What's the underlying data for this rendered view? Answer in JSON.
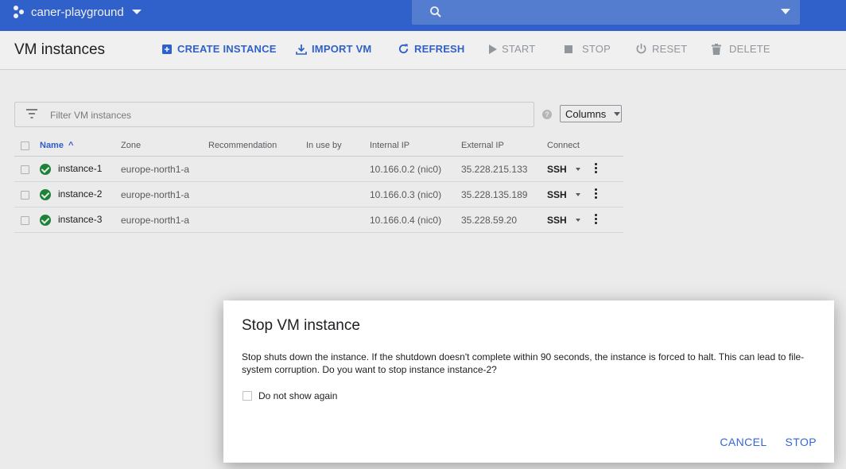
{
  "topbar": {
    "project_name": "caner-playground",
    "search_placeholder": ""
  },
  "toolbar": {
    "page_title": "VM instances",
    "create_instance": "CREATE INSTANCE",
    "import_vm": "IMPORT VM",
    "refresh": "REFRESH",
    "start": "START",
    "stop": "STOP",
    "reset": "RESET",
    "delete": "DELETE"
  },
  "filter": {
    "placeholder": "Filter VM instances",
    "help": "?",
    "columns_label": "Columns"
  },
  "table": {
    "headers": {
      "name": "Name",
      "zone": "Zone",
      "recommendation": "Recommendation",
      "in_use_by": "In use by",
      "internal_ip": "Internal IP",
      "external_ip": "External IP",
      "connect": "Connect"
    },
    "sort_indicator": "^",
    "rows": [
      {
        "name": "instance-1",
        "zone": "europe-north1-a",
        "recommendation": "",
        "in_use_by": "",
        "internal_ip": "10.166.0.2 (nic0)",
        "external_ip": "35.228.215.133",
        "connect": "SSH"
      },
      {
        "name": "instance-2",
        "zone": "europe-north1-a",
        "recommendation": "",
        "in_use_by": "",
        "internal_ip": "10.166.0.3 (nic0)",
        "external_ip": "35.228.135.189",
        "connect": "SSH"
      },
      {
        "name": "instance-3",
        "zone": "europe-north1-a",
        "recommendation": "",
        "in_use_by": "",
        "internal_ip": "10.166.0.4 (nic0)",
        "external_ip": "35.228.59.20",
        "connect": "SSH"
      }
    ]
  },
  "dialog": {
    "title": "Stop VM instance",
    "message": "Stop shuts down the instance. If the shutdown doesn't complete within 90 seconds, the instance is forced to halt. This can lead to file-system corruption. Do you want to stop instance instance-2?",
    "checkbox_label": "Do not show again",
    "cancel": "CANCEL",
    "confirm": "STOP"
  },
  "colors": {
    "brand_blue": "#3367d6",
    "status_green": "#1e8e3e",
    "disabled_gray": "#9aa0a6"
  }
}
